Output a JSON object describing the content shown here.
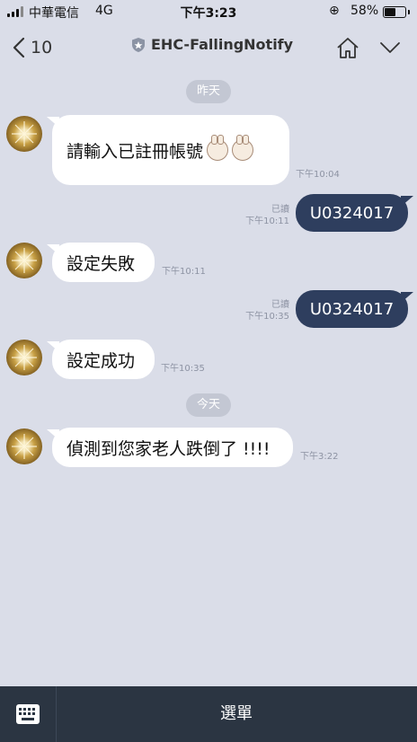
{
  "status_bar": {
    "carrier": "中華電信",
    "network": "4G",
    "time": "下午3:23",
    "battery_percent": "58%",
    "battery_level": 0.58
  },
  "header": {
    "back_count": "10",
    "title": "EHC-FallingNotify"
  },
  "dates": {
    "yesterday": "昨天",
    "today": "今天"
  },
  "messages": [
    {
      "direction": "in",
      "text": "請輸入已註冊帳號",
      "time": "下午10:04"
    },
    {
      "direction": "out",
      "text": "U0324017",
      "read": "已讀",
      "time": "下午10:11"
    },
    {
      "direction": "in",
      "text": "設定失敗",
      "time": "下午10:11"
    },
    {
      "direction": "out",
      "text": "U0324017",
      "read": "已讀",
      "time": "下午10:35"
    },
    {
      "direction": "in",
      "text": "設定成功",
      "time": "下午10:35"
    },
    {
      "direction": "in",
      "text": "偵測到您家老人跌倒了 !!!!",
      "time": "下午3:22"
    }
  ],
  "bottom_bar": {
    "menu_label": "選單"
  },
  "colors": {
    "background": "#dadde8",
    "outgoing_bubble": "#2e3e5e",
    "incoming_bubble": "#ffffff",
    "bottom_bar": "#2b3542"
  }
}
